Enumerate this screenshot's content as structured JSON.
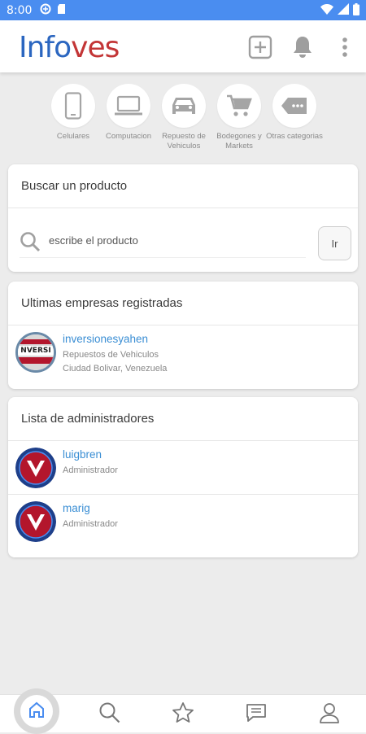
{
  "status_bar": {
    "time": "8:00"
  },
  "app": {
    "logo_part1": "Info",
    "logo_part2": "ves"
  },
  "categories": [
    {
      "label": "Celulares",
      "icon": "phone-icon"
    },
    {
      "label": "Computacion",
      "icon": "laptop-icon"
    },
    {
      "label": "Repuesto de Vehiculos",
      "icon": "car-icon"
    },
    {
      "label": "Bodegones y Markets",
      "icon": "cart-icon"
    },
    {
      "label": "Otras categorias",
      "icon": "tag-icon"
    }
  ],
  "search": {
    "title": "Buscar un producto",
    "placeholder": "escribe el producto",
    "button_label": "Ir"
  },
  "companies": {
    "title": "Ultimas empresas registradas",
    "items": [
      {
        "name": "inversionesyahen",
        "category": "Repuestos de Vehiculos",
        "location": "Ciudad Bolivar, Venezuela",
        "avatar_text": "NVERSI"
      }
    ]
  },
  "admins": {
    "title": "Lista de administradores",
    "items": [
      {
        "name": "luigbren",
        "role": "Administrador"
      },
      {
        "name": "marig",
        "role": "Administrador"
      }
    ]
  },
  "colors": {
    "status_bar": "#4a8df0",
    "logo_blue": "#2b66c0",
    "logo_red": "#c33536",
    "link_blue": "#3a8ed4",
    "avatar_red": "#b3162c"
  }
}
